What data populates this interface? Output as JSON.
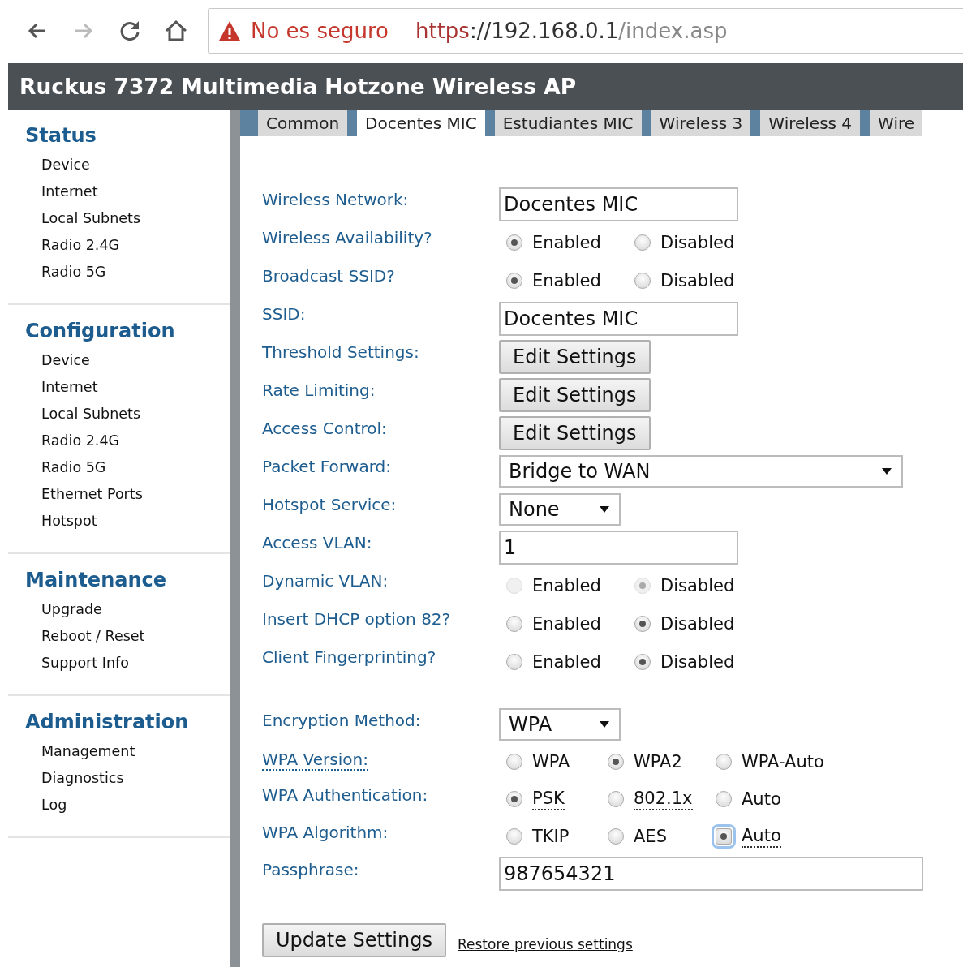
{
  "browser": {
    "security_warning": "No es seguro",
    "url": {
      "scheme": "https",
      "host": "://192.168.0.1",
      "path": "/index.asp"
    }
  },
  "header": {
    "title": "Ruckus 7372 Multimedia Hotzone Wireless AP"
  },
  "sidebar": {
    "sections": [
      {
        "title": "Status",
        "items": [
          "Device",
          "Internet",
          "Local Subnets",
          "Radio 2.4G",
          "Radio 5G"
        ]
      },
      {
        "title": "Configuration",
        "items": [
          "Device",
          "Internet",
          "Local Subnets",
          "Radio 2.4G",
          "Radio 5G",
          "Ethernet Ports",
          "Hotspot"
        ]
      },
      {
        "title": "Maintenance",
        "items": [
          "Upgrade",
          "Reboot / Reset",
          "Support Info"
        ]
      },
      {
        "title": "Administration",
        "items": [
          "Management",
          "Diagnostics",
          "Log"
        ]
      }
    ]
  },
  "tabs": [
    {
      "label": "Common",
      "selected": false
    },
    {
      "label": "Docentes MIC",
      "selected": true
    },
    {
      "label": "Estudiantes MIC",
      "selected": false
    },
    {
      "label": "Wireless 3",
      "selected": false
    },
    {
      "label": "Wireless 4",
      "selected": false
    },
    {
      "label": "Wire",
      "selected": false
    }
  ],
  "form": {
    "rows": [
      {
        "kind": "text",
        "label": "Wireless Network:",
        "value": "Docentes MIC"
      },
      {
        "kind": "radio",
        "label": "Wireless Availability?",
        "options": [
          {
            "label": "Enabled",
            "selected": true,
            "disabled": false
          },
          {
            "label": "Disabled",
            "selected": false,
            "disabled": false
          }
        ]
      },
      {
        "kind": "radio",
        "label": "Broadcast SSID?",
        "options": [
          {
            "label": "Enabled",
            "selected": true,
            "disabled": false
          },
          {
            "label": "Disabled",
            "selected": false,
            "disabled": false
          }
        ]
      },
      {
        "kind": "text",
        "label": "SSID:",
        "value": "Docentes MIC"
      },
      {
        "kind": "button",
        "label": "Threshold Settings:",
        "button": "Edit Settings"
      },
      {
        "kind": "button",
        "label": "Rate Limiting:",
        "button": "Edit Settings"
      },
      {
        "kind": "button",
        "label": "Access Control:",
        "button": "Edit Settings"
      },
      {
        "kind": "select",
        "label": "Packet Forward:",
        "value": "Bridge to WAN"
      },
      {
        "kind": "select",
        "label": "Hotspot Service:",
        "value": "None"
      },
      {
        "kind": "text",
        "label": "Access VLAN:",
        "value": "1"
      },
      {
        "kind": "radio",
        "label": "Dynamic VLAN:",
        "options": [
          {
            "label": "Enabled",
            "selected": false,
            "disabled": true
          },
          {
            "label": "Disabled",
            "selected": true,
            "disabled": true
          }
        ]
      },
      {
        "kind": "radio",
        "label": "Insert DHCP option 82?",
        "options": [
          {
            "label": "Enabled",
            "selected": false,
            "disabled": false
          },
          {
            "label": "Disabled",
            "selected": true,
            "disabled": false
          }
        ]
      },
      {
        "kind": "radio",
        "label": "Client Fingerprinting?",
        "options": [
          {
            "label": "Enabled",
            "selected": false,
            "disabled": false
          },
          {
            "label": "Disabled",
            "selected": true,
            "disabled": false
          }
        ]
      },
      {
        "kind": "gap"
      },
      {
        "kind": "select",
        "label": "Encryption Method:",
        "value": "WPA"
      },
      {
        "kind": "radio",
        "label": "WPA Version:",
        "dotted": true,
        "options": [
          {
            "label": "WPA",
            "selected": false,
            "disabled": false
          },
          {
            "label": "WPA2",
            "selected": true,
            "disabled": false
          },
          {
            "label": "WPA-Auto",
            "selected": false,
            "disabled": false
          }
        ]
      },
      {
        "kind": "radio",
        "label": "WPA Authentication:",
        "options": [
          {
            "label": "PSK",
            "selected": true,
            "disabled": false,
            "dotted": true
          },
          {
            "label": "802.1x",
            "selected": false,
            "disabled": false,
            "dotted": true
          },
          {
            "label": "Auto",
            "selected": false,
            "disabled": false,
            "dotted": false
          }
        ]
      },
      {
        "kind": "radio",
        "label": "WPA Algorithm:",
        "options": [
          {
            "label": "TKIP",
            "selected": false,
            "disabled": false,
            "dotted": false
          },
          {
            "label": "AES",
            "selected": false,
            "disabled": false,
            "dotted": false
          },
          {
            "label": "Auto",
            "selected": true,
            "disabled": false,
            "dotted": true,
            "focused": true
          }
        ]
      },
      {
        "kind": "passphrase",
        "label": "Passphrase:",
        "value": "987654321"
      }
    ]
  },
  "actions": {
    "submit": "Update Settings",
    "restore": "Restore previous settings"
  }
}
